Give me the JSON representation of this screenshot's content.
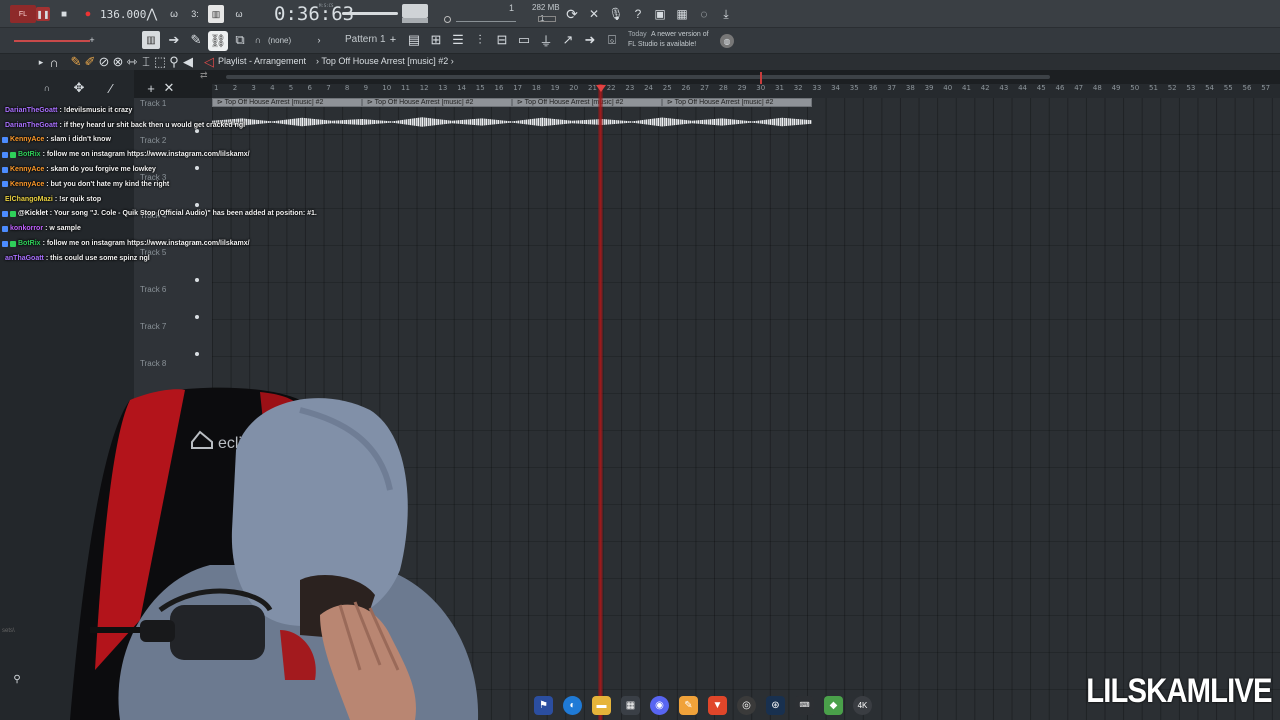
{
  "toolbar": {
    "tempo": "136.000",
    "time": "0:36:63",
    "time_unit": "M:S:CS",
    "memory": "282 MB",
    "cpu": "1",
    "step": "1",
    "pattern": "Pattern 1",
    "snap": "(none)",
    "news_label": "Today",
    "news_text_1": "A newer version of",
    "news_text_2": "FL Studio is available!"
  },
  "playlist": {
    "title": "Playlist - Arrangement",
    "breadcrumb": "Top Off  House Arrest [music] #2",
    "clip_label": "Top Off  House Arrest [music] #2",
    "tracks": [
      "Track 1",
      "Track 2",
      "Track 3",
      "Track 4",
      "Track 5",
      "Track 6",
      "Track 7",
      "Track 8"
    ],
    "ruler": [
      "1",
      "2",
      "3",
      "4",
      "5",
      "6",
      "7",
      "8",
      "9",
      "10",
      "11",
      "12",
      "13",
      "14",
      "15",
      "16",
      "17",
      "18",
      "19",
      "20",
      "21",
      "22",
      "23",
      "24",
      "25",
      "26",
      "27",
      "28",
      "29",
      "30",
      "31",
      "32",
      "33",
      "34",
      "35",
      "36",
      "37",
      "38",
      "39",
      "40",
      "41",
      "42",
      "43",
      "44",
      "45",
      "46",
      "47",
      "48",
      "49",
      "50",
      "51",
      "52",
      "53",
      "54",
      "55",
      "56",
      "57"
    ]
  },
  "chat": [
    {
      "user": "DarianTheGoatt",
      "text": "!devilsmusic it crazy",
      "color": "#a970ff",
      "badges": []
    },
    {
      "user": "DarianTheGoatt",
      "text": "if they heard ur shit back then u would get cracked ngl",
      "color": "#a970ff",
      "badges": []
    },
    {
      "user": "KennyAce",
      "text": "slam i didn't know",
      "color": "#ff9a2a",
      "badges": [
        "#4c8cff"
      ]
    },
    {
      "user": "BotRix",
      "text": "follow me on instagram https://www.instagram.com/lilskamx/",
      "color": "#2fd05a",
      "badges": [
        "#4c8cff",
        "#2fd05a"
      ]
    },
    {
      "user": "KennyAce",
      "text": "skam do you forgive me lowkey",
      "color": "#ff9a2a",
      "badges": [
        "#4c8cff"
      ]
    },
    {
      "user": "KennyAce",
      "text": "but you don't hate my kind the right",
      "color": "#ff9a2a",
      "badges": [
        "#4c8cff"
      ]
    },
    {
      "user": "ElChangoMazi",
      "text": "!sr quik stop",
      "color": "#e8d040",
      "badges": []
    },
    {
      "user": "@Kicklet",
      "text": "Your song \"J. Cole - Quik Stop (Official Audio)\" has been added at position: #1.",
      "color": "#ffffff",
      "badges": [
        "#4c8cff",
        "#2fd05a"
      ]
    },
    {
      "user": "konkorror",
      "text": "w sample",
      "color": "#c060ff",
      "badges": [
        "#4c8cff"
      ]
    },
    {
      "user": "BotRix",
      "text": "follow me on instagram https://www.instagram.com/lilskamx/",
      "color": "#2fd05a",
      "badges": [
        "#4c8cff",
        "#2fd05a"
      ]
    },
    {
      "user": "anThaGoatt",
      "text": "this could use some spinz ngl",
      "color": "#a970ff",
      "badges": []
    }
  ],
  "webcam": {
    "chair_brand": "eclipse"
  },
  "left_panel": {
    "label": "sets\\"
  },
  "watermark": "LILSKAMLIVE",
  "taskbar": [
    "flag-icon",
    "edge-icon",
    "folder-icon",
    "store-icon",
    "discord-icon",
    "pen-icon",
    "brave-icon",
    "chrome-icon",
    "steam-icon",
    "keyboard-app-icon",
    "game-icon",
    "4k-icon"
  ]
}
